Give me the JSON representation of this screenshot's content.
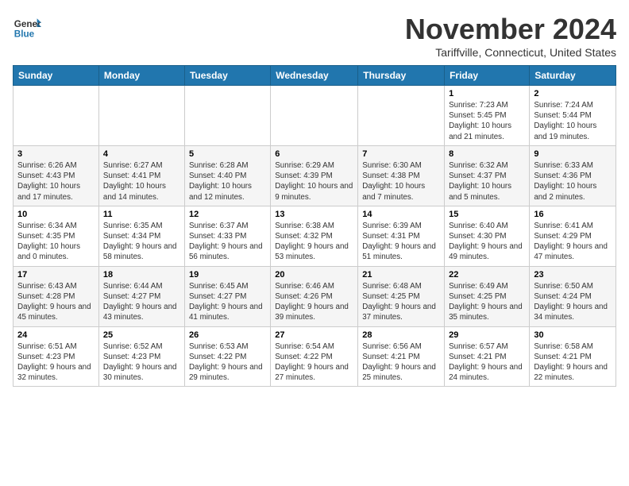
{
  "logo": {
    "line1": "General",
    "line2": "Blue"
  },
  "title": "November 2024",
  "location": "Tariffville, Connecticut, United States",
  "days_of_week": [
    "Sunday",
    "Monday",
    "Tuesday",
    "Wednesday",
    "Thursday",
    "Friday",
    "Saturday"
  ],
  "weeks": [
    [
      {
        "day": "",
        "info": ""
      },
      {
        "day": "",
        "info": ""
      },
      {
        "day": "",
        "info": ""
      },
      {
        "day": "",
        "info": ""
      },
      {
        "day": "",
        "info": ""
      },
      {
        "day": "1",
        "info": "Sunrise: 7:23 AM\nSunset: 5:45 PM\nDaylight: 10 hours and 21 minutes."
      },
      {
        "day": "2",
        "info": "Sunrise: 7:24 AM\nSunset: 5:44 PM\nDaylight: 10 hours and 19 minutes."
      }
    ],
    [
      {
        "day": "3",
        "info": "Sunrise: 6:26 AM\nSunset: 4:43 PM\nDaylight: 10 hours and 17 minutes."
      },
      {
        "day": "4",
        "info": "Sunrise: 6:27 AM\nSunset: 4:41 PM\nDaylight: 10 hours and 14 minutes."
      },
      {
        "day": "5",
        "info": "Sunrise: 6:28 AM\nSunset: 4:40 PM\nDaylight: 10 hours and 12 minutes."
      },
      {
        "day": "6",
        "info": "Sunrise: 6:29 AM\nSunset: 4:39 PM\nDaylight: 10 hours and 9 minutes."
      },
      {
        "day": "7",
        "info": "Sunrise: 6:30 AM\nSunset: 4:38 PM\nDaylight: 10 hours and 7 minutes."
      },
      {
        "day": "8",
        "info": "Sunrise: 6:32 AM\nSunset: 4:37 PM\nDaylight: 10 hours and 5 minutes."
      },
      {
        "day": "9",
        "info": "Sunrise: 6:33 AM\nSunset: 4:36 PM\nDaylight: 10 hours and 2 minutes."
      }
    ],
    [
      {
        "day": "10",
        "info": "Sunrise: 6:34 AM\nSunset: 4:35 PM\nDaylight: 10 hours and 0 minutes."
      },
      {
        "day": "11",
        "info": "Sunrise: 6:35 AM\nSunset: 4:34 PM\nDaylight: 9 hours and 58 minutes."
      },
      {
        "day": "12",
        "info": "Sunrise: 6:37 AM\nSunset: 4:33 PM\nDaylight: 9 hours and 56 minutes."
      },
      {
        "day": "13",
        "info": "Sunrise: 6:38 AM\nSunset: 4:32 PM\nDaylight: 9 hours and 53 minutes."
      },
      {
        "day": "14",
        "info": "Sunrise: 6:39 AM\nSunset: 4:31 PM\nDaylight: 9 hours and 51 minutes."
      },
      {
        "day": "15",
        "info": "Sunrise: 6:40 AM\nSunset: 4:30 PM\nDaylight: 9 hours and 49 minutes."
      },
      {
        "day": "16",
        "info": "Sunrise: 6:41 AM\nSunset: 4:29 PM\nDaylight: 9 hours and 47 minutes."
      }
    ],
    [
      {
        "day": "17",
        "info": "Sunrise: 6:43 AM\nSunset: 4:28 PM\nDaylight: 9 hours and 45 minutes."
      },
      {
        "day": "18",
        "info": "Sunrise: 6:44 AM\nSunset: 4:27 PM\nDaylight: 9 hours and 43 minutes."
      },
      {
        "day": "19",
        "info": "Sunrise: 6:45 AM\nSunset: 4:27 PM\nDaylight: 9 hours and 41 minutes."
      },
      {
        "day": "20",
        "info": "Sunrise: 6:46 AM\nSunset: 4:26 PM\nDaylight: 9 hours and 39 minutes."
      },
      {
        "day": "21",
        "info": "Sunrise: 6:48 AM\nSunset: 4:25 PM\nDaylight: 9 hours and 37 minutes."
      },
      {
        "day": "22",
        "info": "Sunrise: 6:49 AM\nSunset: 4:25 PM\nDaylight: 9 hours and 35 minutes."
      },
      {
        "day": "23",
        "info": "Sunrise: 6:50 AM\nSunset: 4:24 PM\nDaylight: 9 hours and 34 minutes."
      }
    ],
    [
      {
        "day": "24",
        "info": "Sunrise: 6:51 AM\nSunset: 4:23 PM\nDaylight: 9 hours and 32 minutes."
      },
      {
        "day": "25",
        "info": "Sunrise: 6:52 AM\nSunset: 4:23 PM\nDaylight: 9 hours and 30 minutes."
      },
      {
        "day": "26",
        "info": "Sunrise: 6:53 AM\nSunset: 4:22 PM\nDaylight: 9 hours and 29 minutes."
      },
      {
        "day": "27",
        "info": "Sunrise: 6:54 AM\nSunset: 4:22 PM\nDaylight: 9 hours and 27 minutes."
      },
      {
        "day": "28",
        "info": "Sunrise: 6:56 AM\nSunset: 4:21 PM\nDaylight: 9 hours and 25 minutes."
      },
      {
        "day": "29",
        "info": "Sunrise: 6:57 AM\nSunset: 4:21 PM\nDaylight: 9 hours and 24 minutes."
      },
      {
        "day": "30",
        "info": "Sunrise: 6:58 AM\nSunset: 4:21 PM\nDaylight: 9 hours and 22 minutes."
      }
    ]
  ]
}
